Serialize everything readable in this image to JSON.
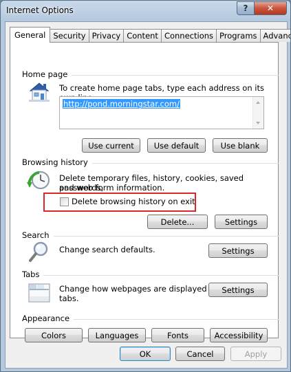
{
  "window": {
    "title": "Internet Options",
    "help_label": "?",
    "close_label": "✕"
  },
  "tabs": [
    {
      "label": "General",
      "active": true
    },
    {
      "label": "Security"
    },
    {
      "label": "Privacy"
    },
    {
      "label": "Content"
    },
    {
      "label": "Connections"
    },
    {
      "label": "Programs"
    },
    {
      "label": "Advanced"
    }
  ],
  "home_page": {
    "heading": "Home page",
    "description": "To create home page tabs, type each address on its own line.",
    "url": "http://pond.morningstar.com/",
    "use_current": "Use current",
    "use_default": "Use default",
    "use_blank": "Use blank"
  },
  "browsing_history": {
    "heading": "Browsing history",
    "description_line1": "Delete temporary files, history, cookies, saved passwords,",
    "description_line2": "and web form information.",
    "delete_on_exit_label": "Delete browsing history on exit",
    "delete_on_exit_checked": false,
    "delete_button": "Delete...",
    "settings_button": "Settings"
  },
  "search": {
    "heading": "Search",
    "description": "Change search defaults.",
    "settings_button": "Settings"
  },
  "tabs_section": {
    "heading": "Tabs",
    "description_line1": "Change how webpages are displayed in",
    "description_line2": "tabs.",
    "settings_button": "Settings"
  },
  "appearance": {
    "heading": "Appearance",
    "colors": "Colors",
    "languages": "Languages",
    "fonts": "Fonts",
    "accessibility": "Accessibility"
  },
  "footer": {
    "ok": "OK",
    "cancel": "Cancel",
    "apply": "Apply"
  },
  "colors": {
    "highlight_border": "#d9262b",
    "selection": "#3399ff"
  }
}
